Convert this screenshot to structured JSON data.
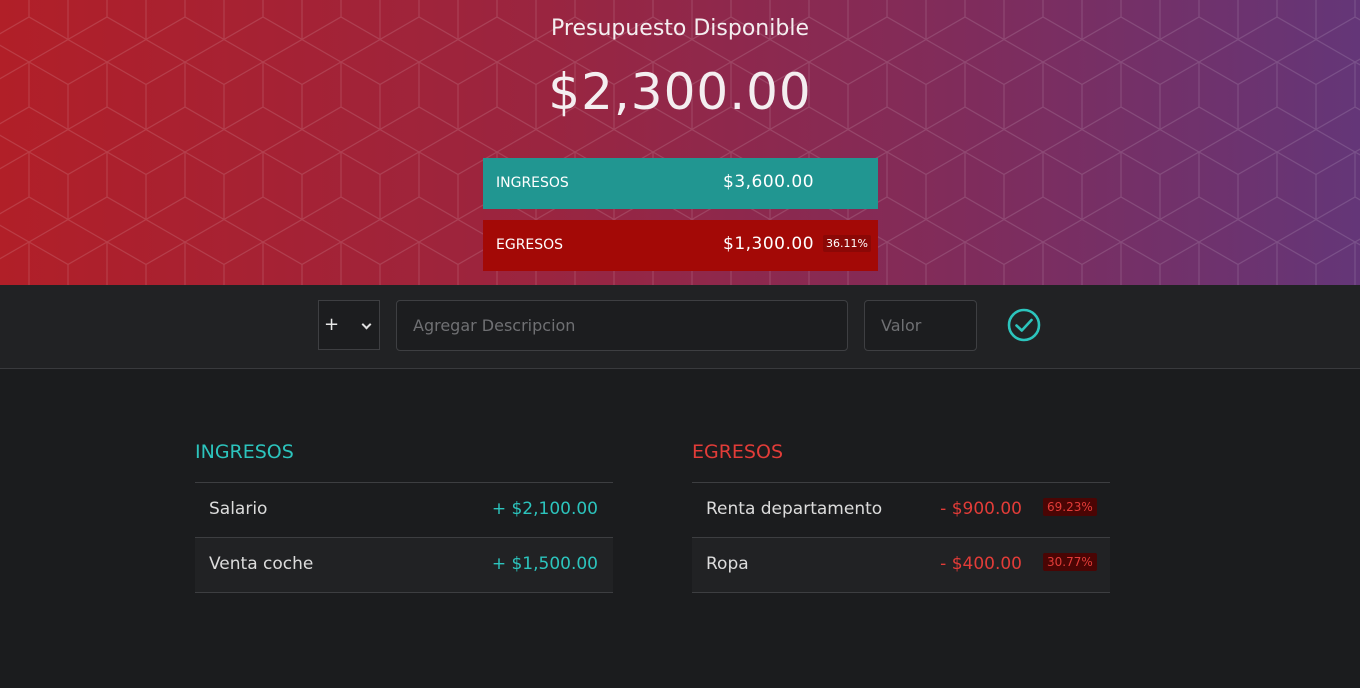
{
  "header": {
    "title": "Presupuesto Disponible",
    "budget": "$2,300.00",
    "income": {
      "label": "INGRESOS",
      "value": "$3,600.00"
    },
    "expense": {
      "label": "EGRESOS",
      "value": "$1,300.00",
      "percent": "36.11%"
    }
  },
  "form": {
    "type_selected": "+",
    "description_placeholder": "Agregar Descripcion",
    "value_placeholder": "Valor",
    "submit_icon": "check-circle-icon"
  },
  "income_list": {
    "title": "INGRESOS",
    "items": [
      {
        "description": "Salario",
        "value": "+ $2,100.00"
      },
      {
        "description": "Venta coche",
        "value": "+ $1,500.00"
      }
    ]
  },
  "expense_list": {
    "title": "EGRESOS",
    "items": [
      {
        "description": "Renta departamento",
        "value": "- $900.00",
        "percent": "69.23%"
      },
      {
        "description": "Ropa",
        "value": "- $400.00",
        "percent": "30.77%"
      }
    ]
  },
  "colors": {
    "income_accent": "#2cc4bd",
    "expense_accent": "#e23c38",
    "income_bar": "#219691",
    "expense_bar": "#a30906"
  }
}
